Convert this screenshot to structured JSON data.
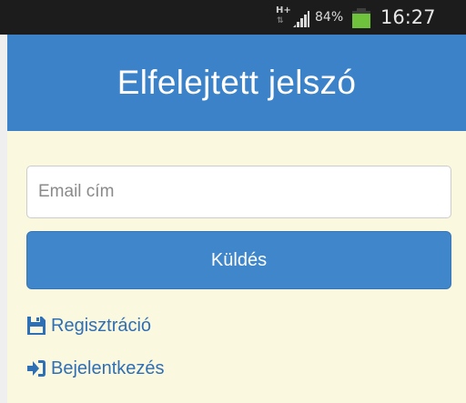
{
  "status_bar": {
    "network_type": "H+",
    "network_arrows": "⇅",
    "battery_percent": "84%",
    "battery_level": 0.84,
    "time": "16:27",
    "icons": [
      "network-type-icon",
      "signal-strength-icon",
      "battery-icon"
    ]
  },
  "header": {
    "title": "Elfelejtett jelszó"
  },
  "form": {
    "email_placeholder": "Email cím",
    "email_value": "",
    "submit_label": "Küldés"
  },
  "links": {
    "register_label": "Regisztráció",
    "register_icon": "floppy-save-icon",
    "login_label": "Bejelentkezés",
    "login_icon": "sign-in-icon"
  },
  "colors": {
    "header_bg": "#3b82c9",
    "page_bg": "#fbf8e0",
    "button_bg": "#3f86cb",
    "link": "#2f6fb3",
    "battery_fill": "#6fc23b"
  }
}
